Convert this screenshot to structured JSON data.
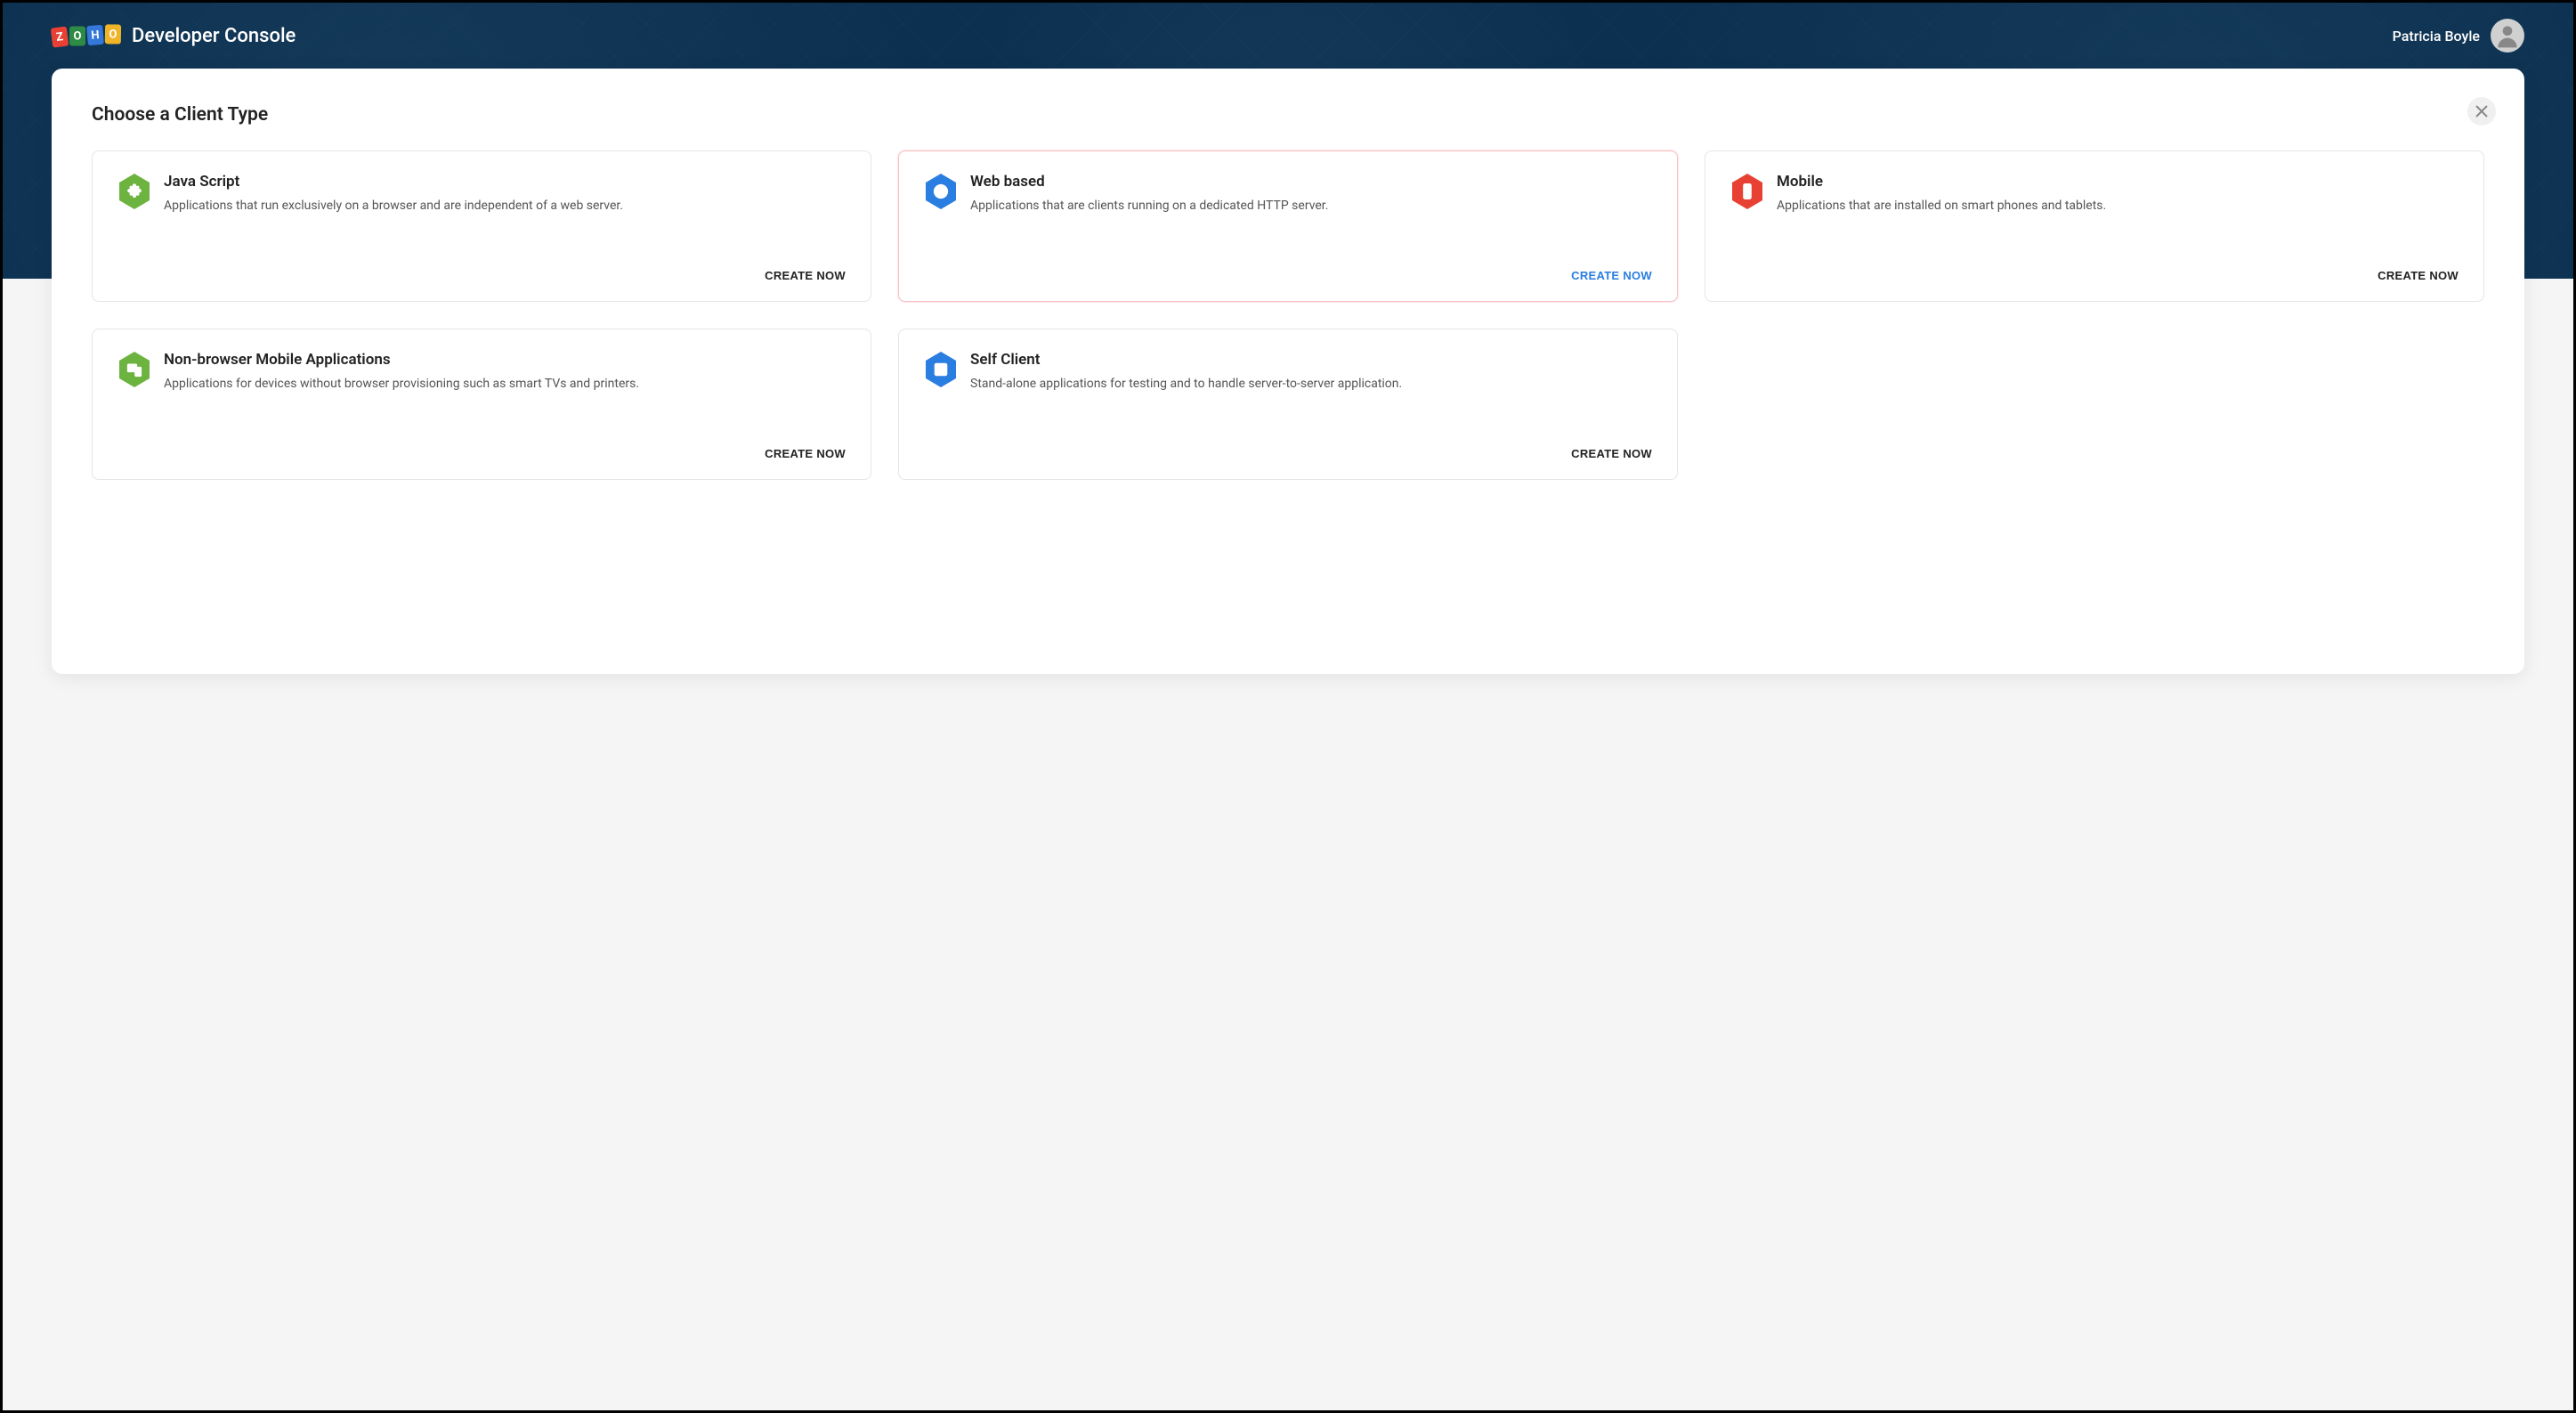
{
  "header": {
    "app_title": "Developer Console",
    "user_name": "Patricia Boyle",
    "logo_letters": [
      "Z",
      "O",
      "H",
      "O"
    ]
  },
  "panel": {
    "title": "Choose a Client Type"
  },
  "cards": [
    {
      "title": "Java Script",
      "description": "Applications that run exclusively on a browser and are independent of a web server.",
      "action": "CREATE NOW",
      "icon": "puzzle",
      "color": "#6cb33f",
      "active": false
    },
    {
      "title": "Web based",
      "description": "Applications that are clients running on a dedicated HTTP server.",
      "action": "CREATE NOW",
      "icon": "globe",
      "color": "#2a7de1",
      "active": true
    },
    {
      "title": "Mobile",
      "description": "Applications that are installed on smart phones and tablets.",
      "action": "CREATE NOW",
      "icon": "mobile",
      "color": "#e84134",
      "active": false
    },
    {
      "title": "Non-browser Mobile Applications",
      "description": "Applications for devices without browser provisioning such as smart TVs and printers.",
      "action": "CREATE NOW",
      "icon": "devices",
      "color": "#6cb33f",
      "active": false
    },
    {
      "title": "Self Client",
      "description": "Stand-alone applications for testing and to handle server-to-server application.",
      "action": "CREATE NOW",
      "icon": "self",
      "color": "#2a7de1",
      "active": false
    }
  ]
}
